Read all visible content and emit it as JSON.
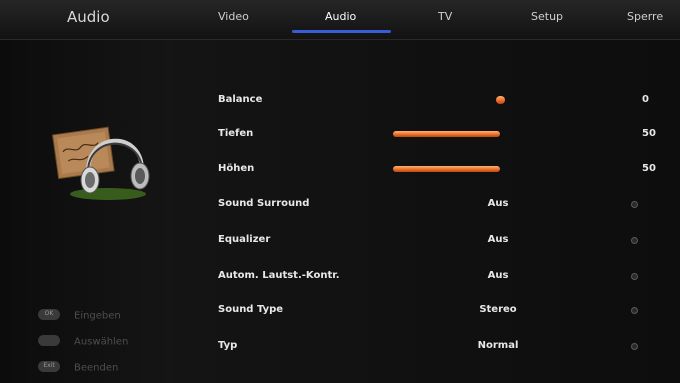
{
  "header": {
    "section_title": "Audio",
    "tabs": [
      {
        "label": "Video"
      },
      {
        "label": "Audio",
        "active": true
      },
      {
        "label": "TV"
      },
      {
        "label": "Setup"
      },
      {
        "label": "Sperre"
      }
    ],
    "accent_color": "#3a5bd6"
  },
  "menu": {
    "items": [
      {
        "label": "Balance",
        "control": "slider",
        "value": "0",
        "level": 0.5
      },
      {
        "label": "Tiefen",
        "control": "slider",
        "value": "50",
        "level": 0.5
      },
      {
        "label": "Höhen",
        "control": "slider",
        "value": "50",
        "level": 0.5
      },
      {
        "label": "Sound Surround",
        "control": "select",
        "value": "Aus"
      },
      {
        "label": "Equalizer",
        "control": "select",
        "value": "Aus"
      },
      {
        "label": "Autom. Lautst.-Kontr.",
        "control": "select",
        "value": "Aus"
      },
      {
        "label": "Sound Type",
        "control": "select",
        "value": "Stereo"
      },
      {
        "label": "Typ",
        "control": "select",
        "value": "Normal"
      }
    ],
    "slider_color": "#e86b22"
  },
  "hints": [
    {
      "key": "OK",
      "label": "Eingeben"
    },
    {
      "key": "",
      "label": "Auswählen"
    },
    {
      "key": "Exit",
      "label": "Beenden"
    }
  ],
  "illustration": {
    "icon": "headphones-note-icon"
  }
}
